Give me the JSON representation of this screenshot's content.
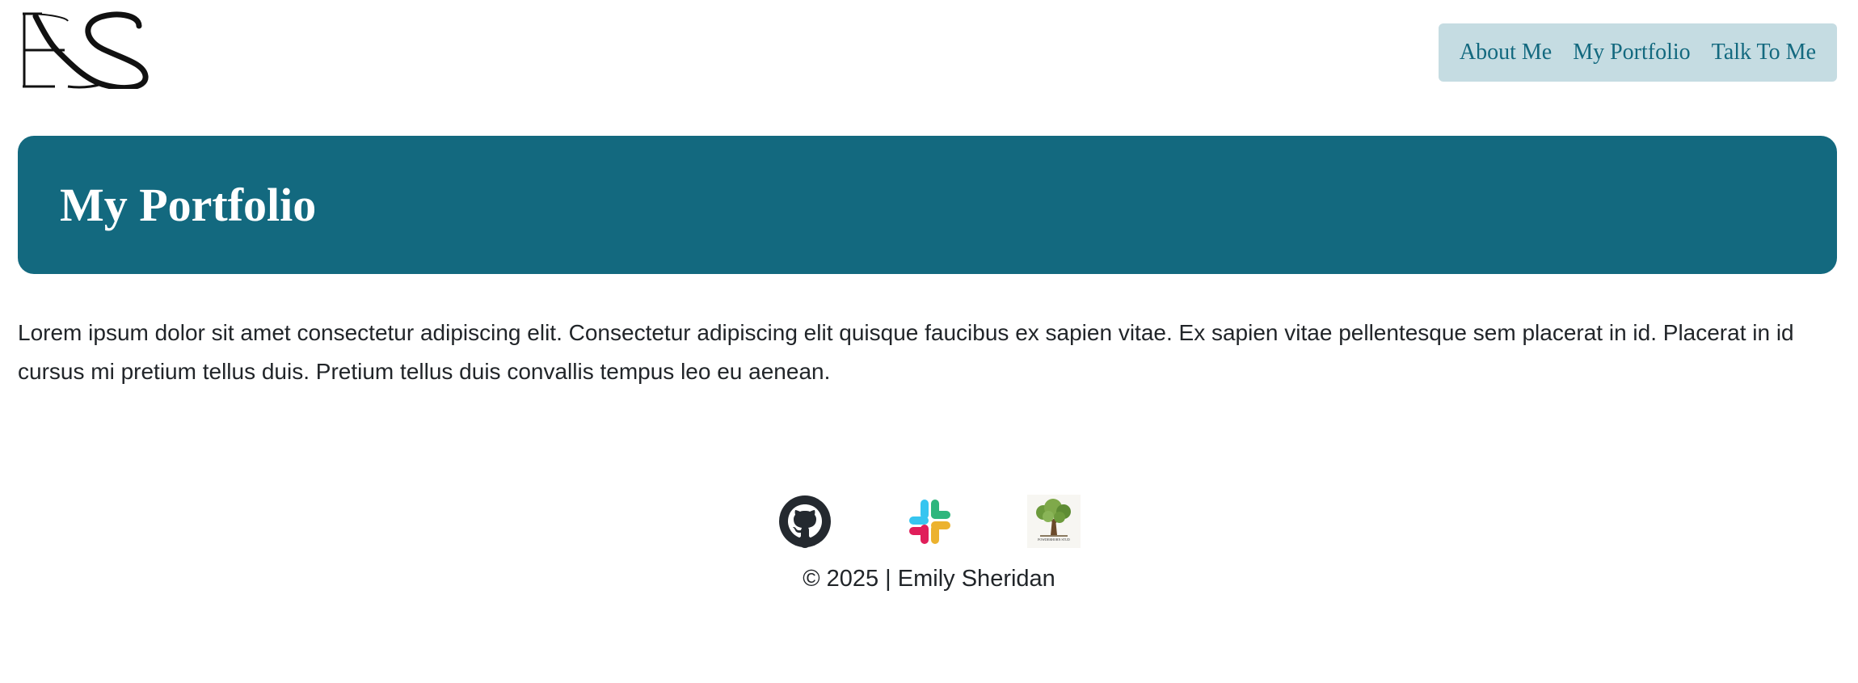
{
  "brand": {
    "logo_text": "ES"
  },
  "nav": {
    "items": [
      {
        "label": "About Me"
      },
      {
        "label": "My Portfolio"
      },
      {
        "label": "Talk To Me"
      }
    ]
  },
  "hero": {
    "title": "My Portfolio"
  },
  "main": {
    "intro": "Lorem ipsum dolor sit amet consectetur adipiscing elit. Consectetur adipiscing elit quisque faucibus ex sapien vitae. Ex sapien vitae pellentesque sem placerat in id. Placerat in id cursus mi pretium tellus duis. Pretium tellus duis convallis tempus leo eu aenean."
  },
  "footer": {
    "social": [
      {
        "icon": "github-icon"
      },
      {
        "icon": "slack-icon"
      },
      {
        "icon": "tree-logo-icon",
        "caption": "POWDERHORN STUD"
      }
    ],
    "copyright": "© 2025 | Emily Sheridan"
  },
  "colors": {
    "accent": "#13697f",
    "nav_background": "#c5dce2",
    "text": "#212529",
    "background": "#ffffff"
  }
}
